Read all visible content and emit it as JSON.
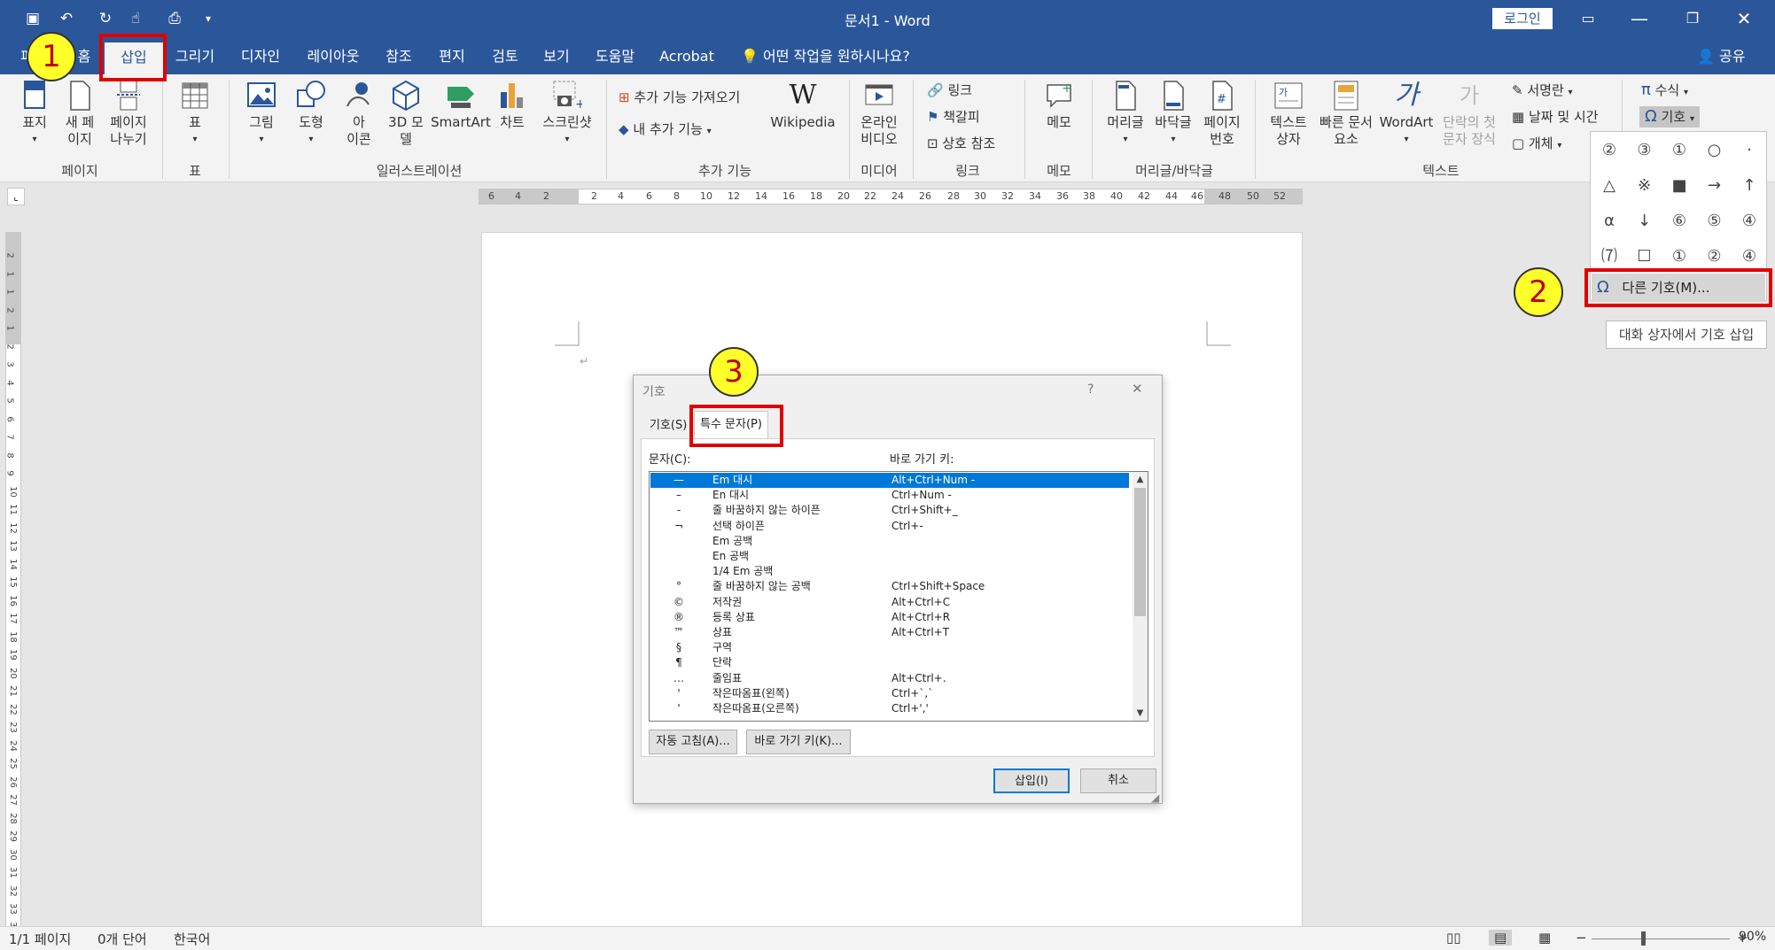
{
  "window": {
    "title": "문서1  -  Word",
    "login_label": "로그인"
  },
  "tabs": {
    "file": "파일",
    "home": "홈",
    "insert": "삽입",
    "draw": "그리기",
    "design": "디자인",
    "layout": "레이아웃",
    "references": "참조",
    "mailings": "편지",
    "review": "검토",
    "view": "보기",
    "help": "도움말",
    "acrobat": "Acrobat",
    "tellme": "어떤 작업을 원하시나요?",
    "share": "공유"
  },
  "ribbon": {
    "cover_page": [
      "표지",
      ""
    ],
    "blank_page": [
      "새 페",
      "이지"
    ],
    "page_break": [
      "페이지",
      "나누기"
    ],
    "group_pages": "페이지",
    "table": "표",
    "group_table": "표",
    "pictures": "그림",
    "shapes": "도형",
    "icons": [
      "아",
      "이콘"
    ],
    "models3d": [
      "3D 모",
      "델"
    ],
    "smartart": "SmartArt",
    "chart": "차트",
    "screenshot": "스크린샷",
    "group_illustrations": "일러스트레이션",
    "get_addins": "추가 기능 가져오기",
    "my_addins": "내 추가 기능",
    "wikipedia": "Wikipedia",
    "group_addins": "추가 기능",
    "online_video": [
      "온라인",
      "비디오"
    ],
    "group_media": "미디어",
    "link": "링크",
    "bookmark": "책갈피",
    "cross_ref": "상호 참조",
    "group_links": "링크",
    "comment": "메모",
    "group_comments": "메모",
    "header": "머리글",
    "footer": "바닥글",
    "page_number": [
      "페이지",
      "번호"
    ],
    "group_header_footer": "머리글/바닥글",
    "textbox": [
      "텍스트",
      "상자"
    ],
    "quick_parts": [
      "빠른 문서",
      "요소"
    ],
    "wordart": "WordArt",
    "dropcap": [
      "단락의 첫",
      "문자 장식"
    ],
    "signature": "서명란",
    "datetime": "날짜 및 시간",
    "object": "개체",
    "group_text": "텍스트",
    "equation": "수식",
    "symbol": "기호"
  },
  "ruler": {
    "h_ticks": [
      "6",
      "4",
      "2",
      "2",
      "4",
      "6",
      "8",
      "10",
      "12",
      "14",
      "16",
      "18",
      "20",
      "22",
      "24",
      "26",
      "28",
      "30",
      "32",
      "34",
      "36",
      "38",
      "40",
      "42",
      "44",
      "46",
      "48",
      "50",
      "52"
    ],
    "v_ticks": [
      "2",
      "1",
      "1",
      "2",
      "1",
      "2",
      "3",
      "4",
      "5",
      "6",
      "7",
      "8",
      "9",
      "10",
      "11",
      "12",
      "13",
      "14",
      "15",
      "16",
      "17",
      "18",
      "19",
      "20",
      "21",
      "22",
      "23",
      "24",
      "25",
      "26",
      "27",
      "28",
      "29",
      "30",
      "31",
      "32",
      "33",
      "34"
    ]
  },
  "gallery": {
    "symbols": [
      "②",
      "③",
      "①",
      "○",
      "·",
      "△",
      "※",
      "■",
      "→",
      "↑",
      "α",
      "↓",
      "⑥",
      "⑤",
      "④",
      "⑺",
      "☐",
      "①",
      "②",
      "④"
    ],
    "more_symbols": "다른 기호(M)...",
    "tooltip": "대화 상자에서 기호 삽입"
  },
  "dialog": {
    "title": "기호",
    "help": "?",
    "close": "✕",
    "tab_symbols": "기호(S)",
    "tab_special": "특수 문자(P)",
    "col_char": "문자(C):",
    "col_shortcut": "바로 가기 키:",
    "rows": [
      {
        "c": "—",
        "name": "Em 대시",
        "key": "Alt+Ctrl+Num -"
      },
      {
        "c": "–",
        "name": "En 대시",
        "key": "Ctrl+Num -"
      },
      {
        "c": "-",
        "name": "줄 바꿈하지 않는 하이픈",
        "key": "Ctrl+Shift+_"
      },
      {
        "c": "¬",
        "name": "선택 하이픈",
        "key": "Ctrl+-"
      },
      {
        "c": "",
        "name": "Em 공백",
        "key": ""
      },
      {
        "c": "",
        "name": "En 공백",
        "key": ""
      },
      {
        "c": "",
        "name": "1/4 Em 공백",
        "key": ""
      },
      {
        "c": "°",
        "name": "줄 바꿈하지 않는 공백",
        "key": "Ctrl+Shift+Space"
      },
      {
        "c": "©",
        "name": "저작권",
        "key": "Alt+Ctrl+C"
      },
      {
        "c": "®",
        "name": "등록 상표",
        "key": "Alt+Ctrl+R"
      },
      {
        "c": "™",
        "name": "상표",
        "key": "Alt+Ctrl+T"
      },
      {
        "c": "§",
        "name": "구역",
        "key": ""
      },
      {
        "c": "¶",
        "name": "단락",
        "key": ""
      },
      {
        "c": "…",
        "name": "줄임표",
        "key": "Alt+Ctrl+."
      },
      {
        "c": "'",
        "name": "작은따옴표(왼쪽)",
        "key": "Ctrl+`,`"
      },
      {
        "c": "'",
        "name": "작은따옴표(오른쪽)",
        "key": "Ctrl+','"
      }
    ],
    "autocorrect": "자동 고침(A)...",
    "shortcut_key": "바로 가기 키(K)...",
    "insert": "삽입(I)",
    "cancel": "취소"
  },
  "status": {
    "page": "1/1 페이지",
    "words": "0개 단어",
    "language": "한국어",
    "zoom": "90%"
  },
  "annotations": {
    "step1": "1",
    "step2": "2",
    "step3": "3"
  }
}
